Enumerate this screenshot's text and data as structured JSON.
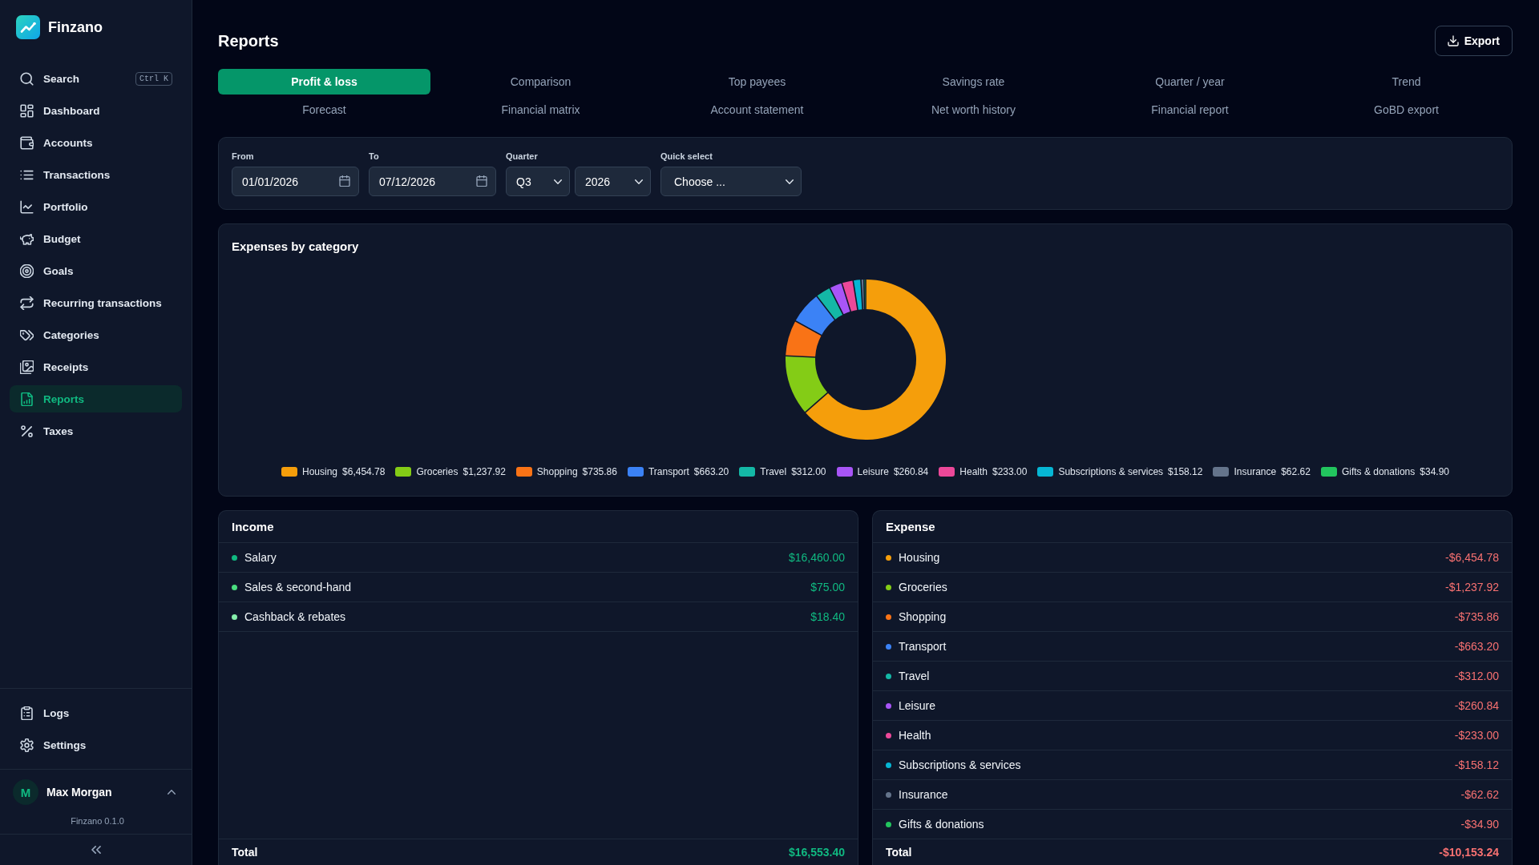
{
  "sidebar": {
    "brand": "Finzano",
    "search": {
      "label": "Search",
      "shortcut": "Ctrl K"
    },
    "nav_items": [
      {
        "label": "Dashboard",
        "selected": false
      },
      {
        "label": "Accounts",
        "selected": false
      },
      {
        "label": "Transactions",
        "selected": false
      },
      {
        "label": "Portfolio",
        "selected": false
      },
      {
        "label": "Budget",
        "selected": false
      },
      {
        "label": "Goals",
        "selected": false
      },
      {
        "label": "Recurring transactions",
        "selected": false
      },
      {
        "label": "Categories",
        "selected": false
      },
      {
        "label": "Receipts",
        "selected": false
      },
      {
        "label": "Reports",
        "selected": true
      },
      {
        "label": "Taxes",
        "selected": false
      }
    ],
    "footer_items": [
      {
        "label": "Logs",
        "selected": false
      },
      {
        "label": "Settings",
        "selected": false
      }
    ],
    "user": {
      "initial": "M",
      "name": "Max Morgan"
    },
    "version": "Finzano 0.1.0"
  },
  "page": {
    "title": "Reports",
    "export_button": "Export"
  },
  "report_tabs": [
    {
      "label": "Profit & loss",
      "selected": true
    },
    {
      "label": "Comparison",
      "selected": false
    },
    {
      "label": "Top payees",
      "selected": false
    },
    {
      "label": "Savings rate",
      "selected": false
    },
    {
      "label": "Quarter / year",
      "selected": false
    },
    {
      "label": "Trend",
      "selected": false
    },
    {
      "label": "Forecast",
      "selected": false
    },
    {
      "label": "Financial matrix",
      "selected": false
    },
    {
      "label": "Account statement",
      "selected": false
    },
    {
      "label": "Net worth history",
      "selected": false
    },
    {
      "label": "Financial report",
      "selected": false
    },
    {
      "label": "GoBD export",
      "selected": false
    }
  ],
  "filters": {
    "from": {
      "label": "From",
      "value": "01/01/2026"
    },
    "to": {
      "label": "To",
      "value": "07/12/2026"
    },
    "quarter": {
      "label": "Quarter",
      "value": "Q3"
    },
    "year": {
      "value": "2026"
    },
    "quick_select": {
      "label": "Quick select",
      "value": "Choose ..."
    }
  },
  "expenses_chart": {
    "chart_data": {
      "type": "donut",
      "title": "Expenses by category",
      "categories": [
        "Housing",
        "Groceries",
        "Shopping",
        "Transport",
        "Travel",
        "Leisure",
        "Health",
        "Subscriptions & services",
        "Insurance",
        "Gifts & donations"
      ],
      "values": [
        6454.78,
        1237.92,
        735.86,
        663.2,
        312.0,
        260.84,
        233.0,
        158.12,
        62.62,
        34.9
      ],
      "colors": [
        "#f59e0b",
        "#84cc16",
        "#f97316",
        "#3b82f6",
        "#14b8a6",
        "#a855f7",
        "#ec4899",
        "#06b6d4",
        "#64748b",
        "#22c55e"
      ],
      "value_labels": [
        "$6,454.78",
        "$1,237.92",
        "$735.86",
        "$663.20",
        "$312.00",
        "$260.84",
        "$233.00",
        "$158.12",
        "$62.62",
        "$34.90"
      ],
      "legend": "bottom"
    }
  },
  "summary_panels": [
    {
      "kind": "income",
      "title": "Income",
      "rows": [
        {
          "label": "Salary",
          "amount": "$16,460.00",
          "color": "#10b981"
        },
        {
          "label": "Sales & second-hand",
          "amount": "$75.00",
          "color": "#4ade80"
        },
        {
          "label": "Cashback & rebates",
          "amount": "$18.40",
          "color": "#86efac"
        }
      ],
      "total": {
        "label": "Total",
        "amount": "$16,553.40"
      }
    },
    {
      "kind": "expense",
      "title": "Expense",
      "rows": [
        {
          "label": "Housing",
          "amount": "-$6,454.78",
          "color": "#f59e0b"
        },
        {
          "label": "Groceries",
          "amount": "-$1,237.92",
          "color": "#84cc16"
        },
        {
          "label": "Shopping",
          "amount": "-$735.86",
          "color": "#f97316"
        },
        {
          "label": "Transport",
          "amount": "-$663.20",
          "color": "#3b82f6"
        },
        {
          "label": "Travel",
          "amount": "-$312.00",
          "color": "#14b8a6"
        },
        {
          "label": "Leisure",
          "amount": "-$260.84",
          "color": "#a855f7"
        },
        {
          "label": "Health",
          "amount": "-$233.00",
          "color": "#ec4899"
        },
        {
          "label": "Subscriptions & services",
          "amount": "-$158.12",
          "color": "#06b6d4"
        },
        {
          "label": "Insurance",
          "amount": "-$62.62",
          "color": "#64748b"
        },
        {
          "label": "Gifts & donations",
          "amount": "-$34.90",
          "color": "#22c55e"
        }
      ],
      "total": {
        "label": "Total",
        "amount": "-$10,153.24"
      }
    }
  ]
}
